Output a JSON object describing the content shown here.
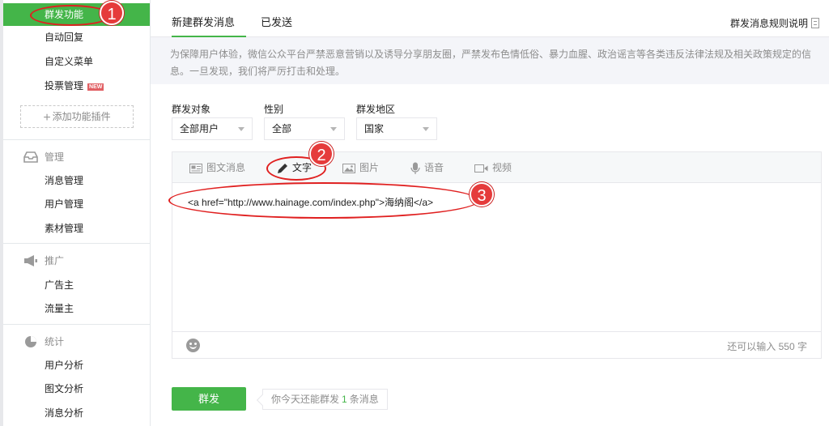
{
  "sidebar": {
    "active_item": "群发功能",
    "top_items": [
      "自动回复",
      "自定义菜单",
      "投票管理"
    ],
    "new_badge": "NEW",
    "add_plugin": "添加功能插件",
    "groups": [
      {
        "title": "管理",
        "icon": "inbox-icon",
        "items": [
          "消息管理",
          "用户管理",
          "素材管理"
        ]
      },
      {
        "title": "推广",
        "icon": "megaphone-icon",
        "items": [
          "广告主",
          "流量主"
        ]
      },
      {
        "title": "统计",
        "icon": "pie-chart-icon",
        "items": [
          "用户分析",
          "图文分析",
          "消息分析"
        ]
      }
    ]
  },
  "tabs": {
    "new_broadcast": "新建群发消息",
    "sent": "已发送"
  },
  "rules_link": "群发消息规则说明",
  "notice": {
    "line1": "为保障用户体验，微信公众平台严禁恶意营销以及诱导分享朋友圈，严禁发布色情低俗、暴力血腥、政治谣言等各类违反法律法规及相关政策规定的信",
    "line2": "息。一旦发现，我们将严厉打击和处理。"
  },
  "filters": {
    "target": {
      "label": "群发对象",
      "value": "全部用户"
    },
    "gender": {
      "label": "性别",
      "value": "全部"
    },
    "region": {
      "label": "群发地区",
      "value": "国家"
    }
  },
  "editor": {
    "tabs": [
      {
        "label": "图文消息",
        "icon": "article-icon"
      },
      {
        "label": "文字",
        "icon": "pencil-icon"
      },
      {
        "label": "图片",
        "icon": "image-icon"
      },
      {
        "label": "语音",
        "icon": "microphone-icon"
      },
      {
        "label": "视频",
        "icon": "video-icon"
      }
    ],
    "active_tab": "文字",
    "content": "<a href=\"http://www.hainage.com/index.php\">海纳阁</a>",
    "remaining": "还可以输入 550 字"
  },
  "send_button": "群发",
  "quota": {
    "prefix": "你今天还能群发",
    "count": "1",
    "suffix": "条消息"
  },
  "annotations": [
    "1",
    "2",
    "3"
  ],
  "colors": {
    "accent": "#44b549",
    "annotation": "#e02020",
    "badge": "#e15f63"
  }
}
